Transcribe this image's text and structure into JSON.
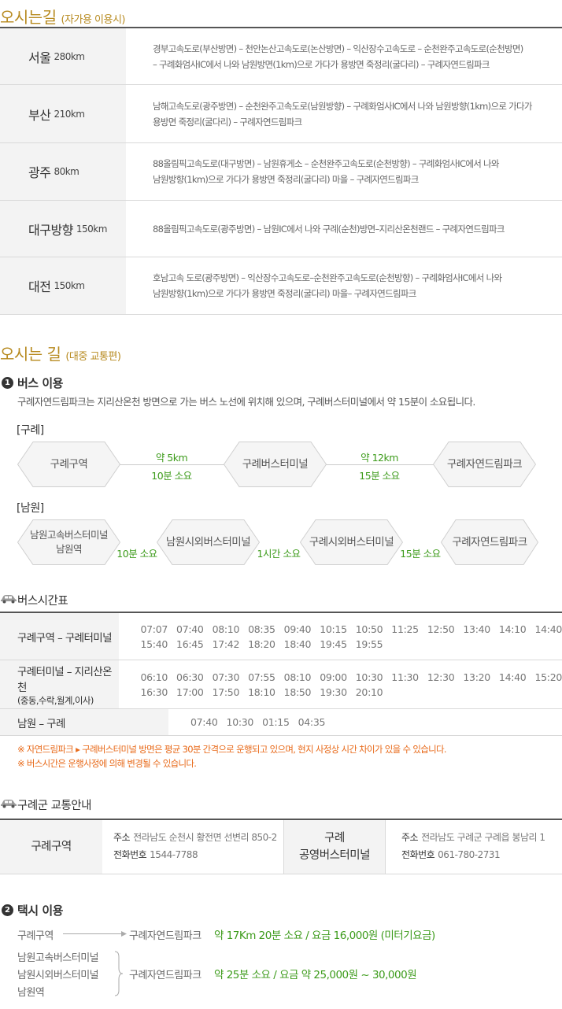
{
  "car_section": {
    "title": "오시는길",
    "subtitle": "(자가용 이용시)",
    "rows": [
      {
        "city": "서울",
        "km": "280km",
        "route": [
          "경부고속도로(부산방면) – 천안논산고속도로(논산방면) – 익산장수고속도로 – 순천완주고속도로(순천방면)",
          "– 구례화엄사IC에서 나와 남원방면(1km)으로 가다가 용방면 죽정리(굴다리) – 구례자연드림파크"
        ]
      },
      {
        "city": "부산",
        "km": "210km",
        "route": [
          "남해고속도로(광주방면) – 순천완주고속도로(남원방향) – 구례화엄사IC에서 나와 남원방향(1km)으로 가다가",
          "용방면 죽정리(굴다리) – 구례자연드림파크"
        ]
      },
      {
        "city": "광주",
        "km": "80km",
        "route": [
          "88올림픽고속도로(대구방면) – 남원휴게소 – 순천완주고속도로(순천방향) – 구례화엄사IC에서 나와",
          "남원방향(1km)으로 가다가 용방면 죽정리(굴다리) 마을 – 구례자연드림파크"
        ]
      },
      {
        "city": "대구방향",
        "km": "150km",
        "route": [
          "88올림픽고속도로(광주방면) – 남원IC에서 나와 구례(순천)방면–지리산온천랜드 – 구례자연드림파크"
        ]
      },
      {
        "city": "대전",
        "km": "150km",
        "route": [
          "호남고속 도로(광주방면) – 익산장수고속도로–순천완주고속도로(순천방향) – 구례화엄사IC에서 나와",
          "남원방향(1km)으로 가다가 용방면 죽정리(굴다리) 마을– 구례자연드림파크"
        ]
      }
    ]
  },
  "public_section": {
    "title": "오시는 길",
    "subtitle": "(대중 교통편)"
  },
  "bus": {
    "num": "1",
    "heading": "버스 이용",
    "desc": "구례자연드림파크는 지리산온천 방면으로 가는 버스 노선에 위치해 있으며, 구례버스터미널에서 약 15분이 소요됩니다.",
    "gurye": {
      "label": "[구례]",
      "nodes": [
        "구례구역",
        "구례버스터미널",
        "구례자연드림파크"
      ],
      "links": [
        {
          "top": "약 5km",
          "bottom": "10분 소요"
        },
        {
          "top": "약 12km",
          "bottom": "15분 소요"
        }
      ]
    },
    "namwon": {
      "label": "[남원]",
      "nodes": [
        "남원고속버스터미널\n남원역",
        "남원시외버스터미널",
        "구례시외버스터미널",
        "구례자연드림파크"
      ],
      "links": [
        "10분 소요",
        "1시간 소요",
        "15분 소요"
      ]
    }
  },
  "timetable": {
    "heading": "버스시간표",
    "rows": [
      {
        "route": "구례구역 – 구례터미널",
        "sub": "",
        "lines": [
          "07:07   07:40   08:10   08:35   09:40   10:15   10:50   11:25   12:50   13:40   14:10   14:40",
          "15:40   16:45   17:42   18:20   18:40   19:45   19:55"
        ]
      },
      {
        "route": "구례터미널 – 지리산온천",
        "sub": "(중동,수락,월계,이사)",
        "lines": [
          "06:10   06:30   07:30   07:55   08:10   09:00   10:30   11:30   12:30   13:20   14:40   15:20",
          "16:30   17:00   17:50   18:10   18:50   19:30   20:10"
        ]
      },
      {
        "route": "남원 – 구례",
        "sub": "",
        "lines": [
          "07:40   10:30   01:15   04:35"
        ]
      }
    ],
    "notes": [
      "※ 자연드림파크 ▸ 구례버스터미널 방면은 평균 30분 간격으로 운행되고 있으며, 현지 사정상 시간 차이가 있을 수 있습니다.",
      "※ 버스시간은 운행사정에 의해 변경될 수 있습니다."
    ]
  },
  "transport_info": {
    "heading": "구례군 교통안내",
    "places": [
      {
        "name": "구례구역",
        "addr_label": "주소",
        "addr": "전라남도 순천시 황전면 선변리 850-2",
        "tel_label": "전화번호",
        "tel": "1544-7788"
      },
      {
        "name": "구례\n공영버스터미널",
        "addr_label": "주소",
        "addr": "전라남도 구례군 구례읍 봉남리 1",
        "tel_label": "전화번호",
        "tel": "061-780-2731"
      }
    ]
  },
  "taxi": {
    "num": "2",
    "heading": "택시 이용",
    "row1": {
      "from": "구례구역",
      "to": "구례자연드림파크",
      "info": "약 17Km 20분 소요 / 요금 16,000원 (미터기요금)"
    },
    "row2": {
      "from": [
        "남원고속버스터미널",
        "남원시외버스터미널",
        "남원역"
      ],
      "to": "구례자연드림파크",
      "info": "약 25분 소요 / 요금 약 25,000원 ~ 30,000원"
    }
  },
  "colors": {
    "accent_gold": "#b78a1f",
    "green": "#3c9b1a",
    "orange_note": "#e86a1a"
  },
  "icons": [
    "car-icon",
    "arrow-right-icon",
    "brace-icon"
  ]
}
